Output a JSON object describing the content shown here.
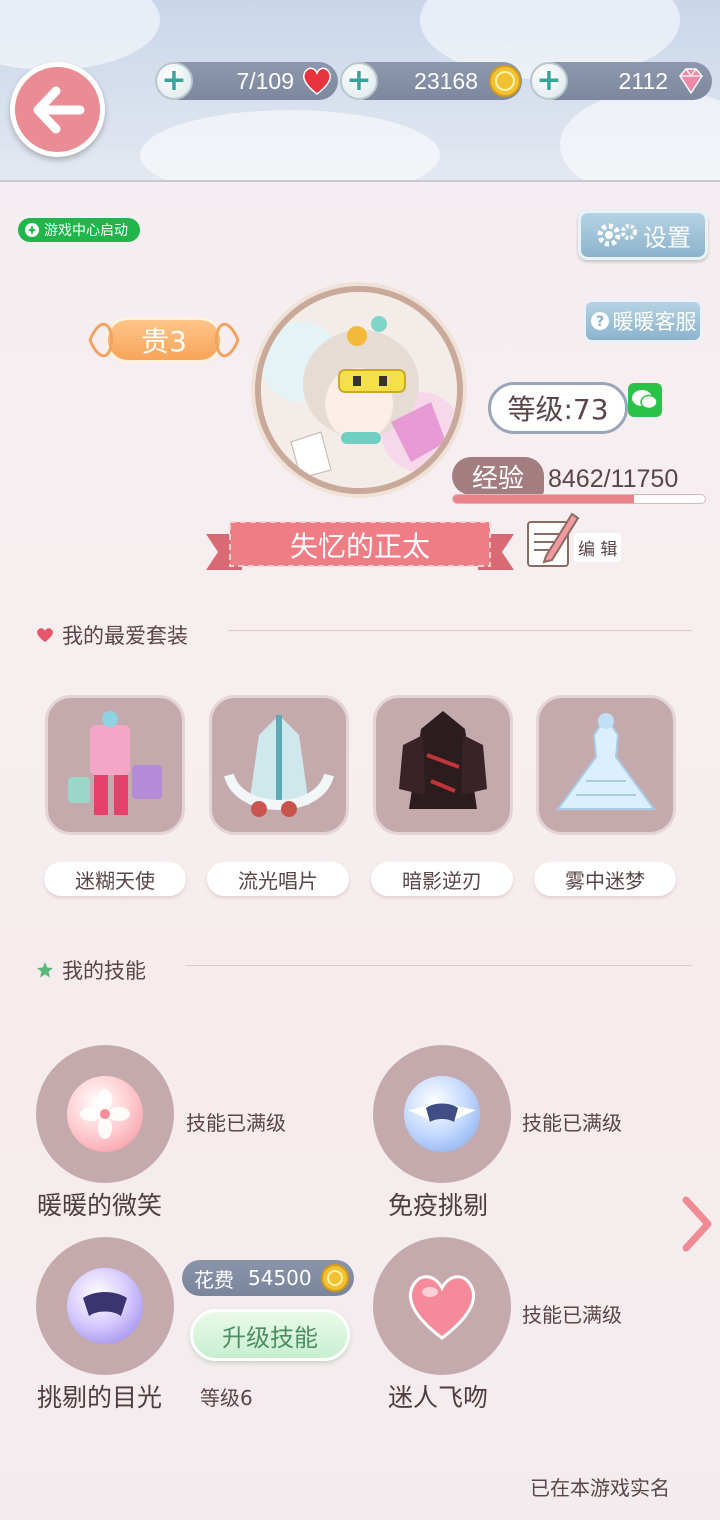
{
  "resources": {
    "stamina": "7/109",
    "gold": "23168",
    "diamonds": "2112"
  },
  "game_center_badge": "游戏中心启动",
  "settings_label": "设置",
  "service_label": "暖暖客服",
  "vip_label": "贵3",
  "level_label": "等级:73",
  "exp": {
    "label": "经验",
    "value": "8462/11750",
    "progress": 0.72
  },
  "player_name": "失忆的正太",
  "edit_label": "编 辑",
  "favorites": {
    "title": "我的最爱套装",
    "items": [
      {
        "label": "迷糊天使"
      },
      {
        "label": "流光唱片"
      },
      {
        "label": "暗影逆刃"
      },
      {
        "label": "雾中迷梦"
      }
    ]
  },
  "skills": {
    "title": "我的技能",
    "items": [
      {
        "name": "暖暖的微笑",
        "status": "技能已满级"
      },
      {
        "name": "免疫挑剔",
        "status": "技能已满级"
      },
      {
        "name": "挑剔的目光",
        "status": "等级6"
      },
      {
        "name": "迷人飞吻",
        "status": "技能已满级"
      }
    ],
    "cost_label": "花费",
    "cost_value": "54500",
    "upgrade_label": "升级技能"
  },
  "realname_text": "已在本游戏实名",
  "colors": {
    "accent_pink": "#e98c93",
    "card_bg": "#c5aaad",
    "green": "#22b54b"
  }
}
